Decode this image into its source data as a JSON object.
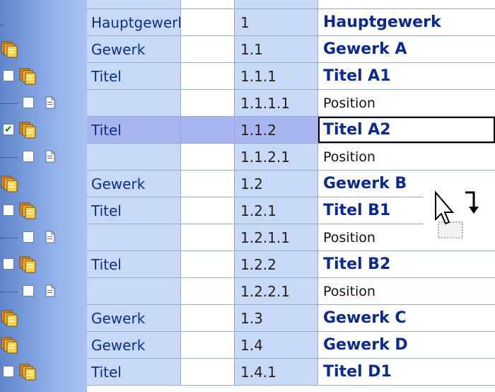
{
  "rows": [
    {
      "type": "Hauptgewerk",
      "num": "1",
      "name": "Hauptgewerk",
      "kind": "group",
      "checked": false
    },
    {
      "type": "Gewerk",
      "num": "1.1",
      "name": "Gewerk A",
      "kind": "group",
      "checked": false
    },
    {
      "type": "Titel",
      "num": "1.1.1",
      "name": "Titel A1",
      "kind": "group",
      "checked": false
    },
    {
      "type": "",
      "num": "1.1.1.1",
      "name": "Position",
      "kind": "pos",
      "checked": false
    },
    {
      "type": "Titel",
      "num": "1.1.2",
      "name": "Titel A2",
      "kind": "group",
      "checked": true,
      "selected": true
    },
    {
      "type": "",
      "num": "1.1.2.1",
      "name": "Position",
      "kind": "pos",
      "checked": false
    },
    {
      "type": "Gewerk",
      "num": "1.2",
      "name": "Gewerk B",
      "kind": "group",
      "checked": false
    },
    {
      "type": "Titel",
      "num": "1.2.1",
      "name": "Titel B1",
      "kind": "group",
      "checked": false
    },
    {
      "type": "",
      "num": "1.2.1.1",
      "name": "Position",
      "kind": "pos",
      "checked": false
    },
    {
      "type": "Titel",
      "num": "1.2.2",
      "name": "Titel B2",
      "kind": "group",
      "checked": false
    },
    {
      "type": "",
      "num": "1.2.2.1",
      "name": "Position",
      "kind": "pos",
      "checked": false
    },
    {
      "type": "Gewerk",
      "num": "1.3",
      "name": "Gewerk C",
      "kind": "group",
      "checked": false
    },
    {
      "type": "Gewerk",
      "num": "1.4",
      "name": "Gewerk D",
      "kind": "group",
      "checked": false
    },
    {
      "type": "Titel",
      "num": "1.4.1",
      "name": "Titel D1",
      "kind": "group",
      "checked": false
    }
  ],
  "icons": {
    "group_icon": "folder-stack-icon",
    "position_icon": "document-icon",
    "checkbox_icon": "checkbox-icon",
    "drag_icon": "drag-drop-cursor-icon"
  },
  "colors": {
    "tree_background": "#7a9ddc",
    "type_column_bg": "#c8d9f7",
    "selected_row_bg": "#a9b5ef",
    "group_text": "#0b2a8f"
  }
}
